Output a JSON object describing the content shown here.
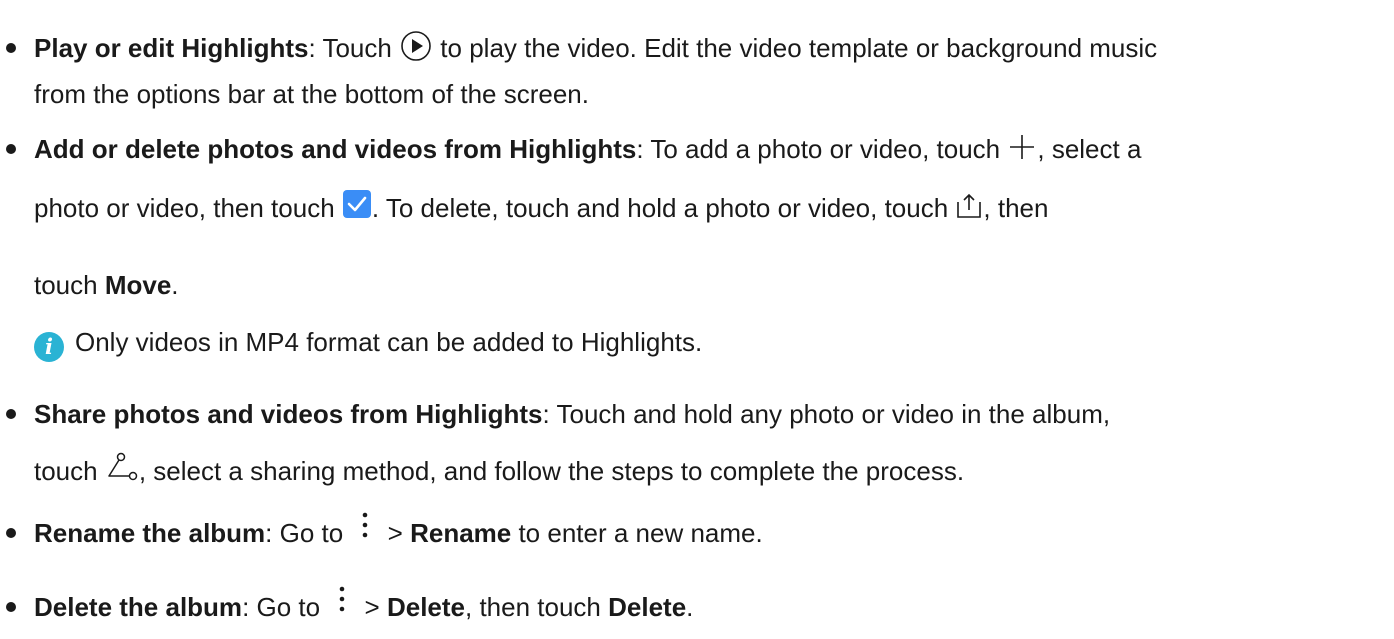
{
  "items": [
    {
      "title": "Play or edit Highlights",
      "l1a": ": Touch ",
      "l1b": " to play the video. Edit the video template or background music",
      "l2": "from the options bar at the bottom of the screen."
    },
    {
      "title": "Add or delete photos and videos from Highlights",
      "l1a": ": To add a photo or video, touch ",
      "l1b": ", select a",
      "l2a": "photo or video, then touch ",
      "l2b": ". To delete, touch and hold a photo or video, touch ",
      "l2c": ", then",
      "l3a": "touch ",
      "l3b": "Move",
      "l3c": ".",
      "note": "Only videos in MP4 format can be added to Highlights."
    },
    {
      "title": "Share photos and videos from Highlights",
      "l1": ": Touch and hold any photo or video in the album,",
      "l2a": "touch ",
      "l2b": ", select a sharing method, and follow the steps to complete the process."
    },
    {
      "title": "Rename the album",
      "a": ": Go to ",
      "b": " > ",
      "c": "Rename",
      "d": " to enter a new name."
    },
    {
      "title": "Delete the album",
      "a": ": Go to ",
      "b": " > ",
      "c": "Delete",
      "d": ", then touch ",
      "e": "Delete",
      "f": "."
    }
  ],
  "icons": {
    "play": "play-circle-icon",
    "add": "plus-icon",
    "confirm": "checkbox-checked-icon",
    "move": "move-out-icon",
    "share": "share-icon",
    "more": "more-vertical-icon",
    "info": "info-icon"
  },
  "colors": {
    "text": "#1a1a1a",
    "check_blue": "#3a8df6",
    "info_blue": "#2ab3d4"
  }
}
